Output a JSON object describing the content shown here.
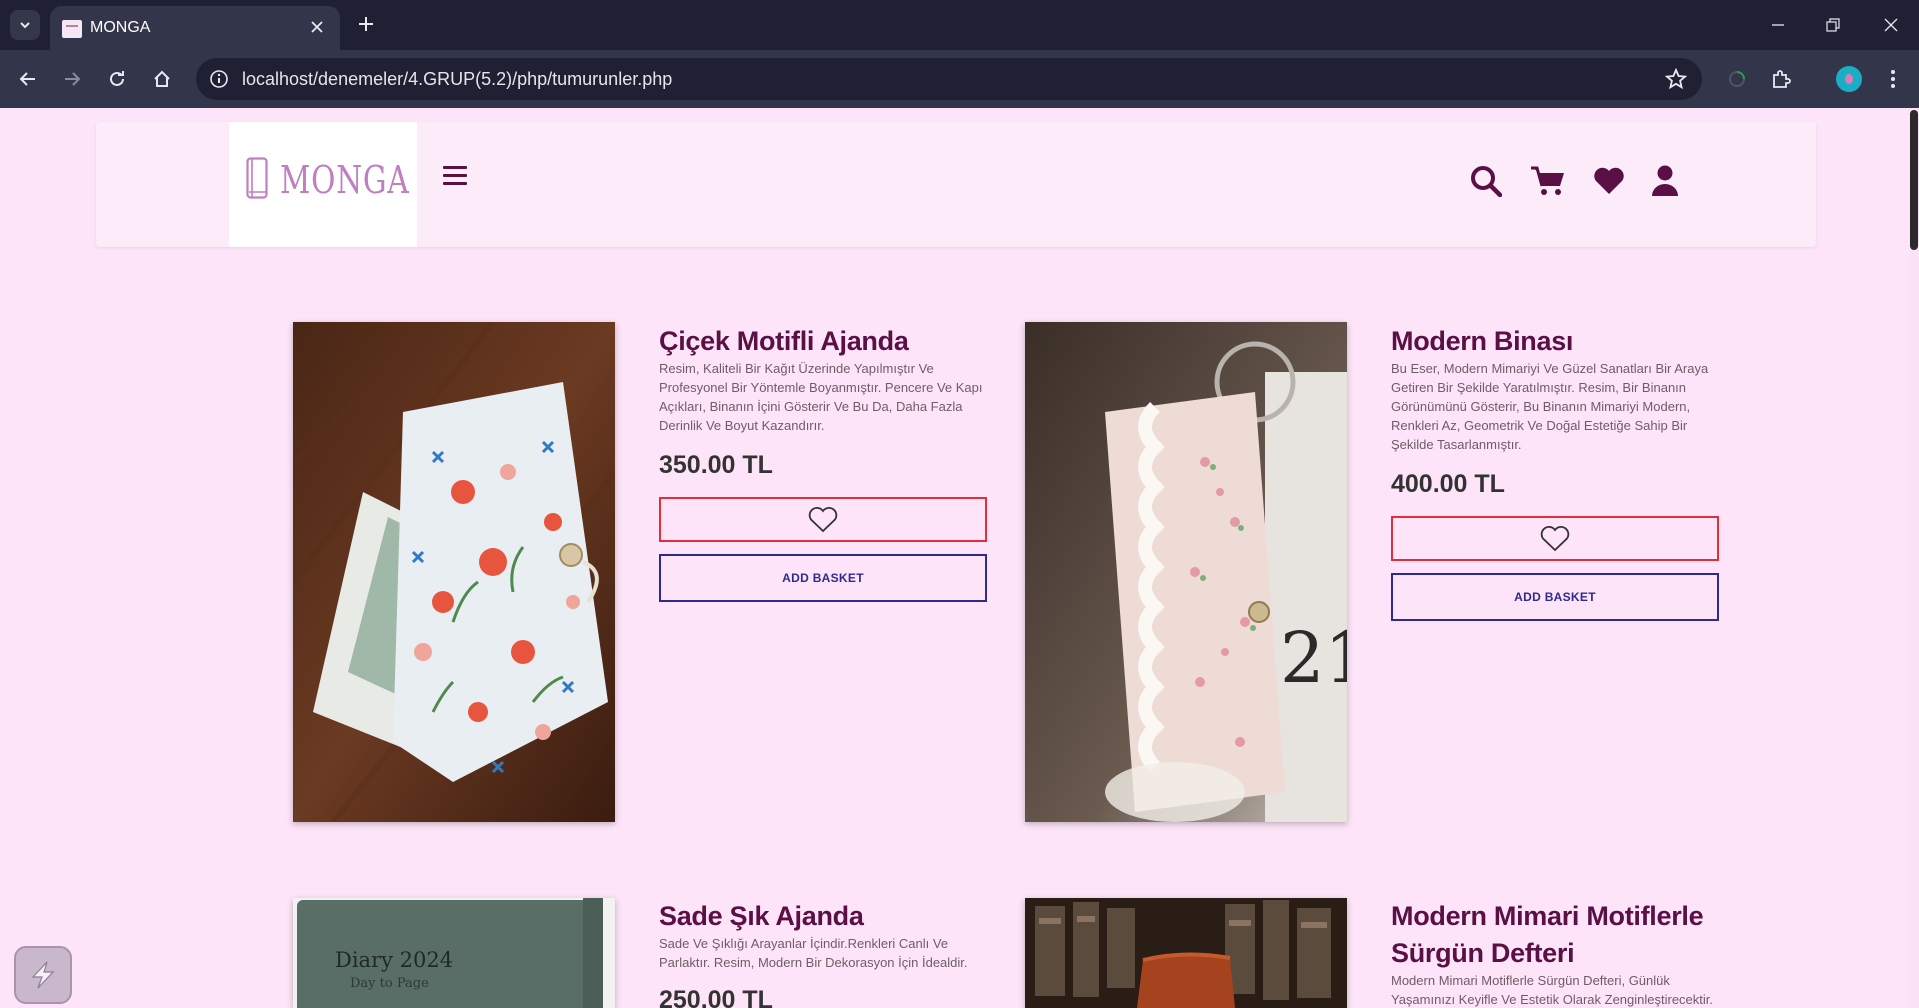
{
  "browser": {
    "tab_title": "MONGA",
    "url": "localhost/denemeler/4.GRUP(5.2)/php/tumurunler.php"
  },
  "header": {
    "logo_text": "MONGA",
    "icons": [
      "search-icon",
      "cart-icon",
      "heart-icon",
      "user-icon"
    ]
  },
  "colors": {
    "page_bg": "#fde4f8",
    "brand": "#5a0f45",
    "favorite_border": "#e02f38",
    "basket_border": "#2e2b8f"
  },
  "products": [
    {
      "title": "Çiçek Motifli Ajanda",
      "description": "Resim, Kaliteli Bir Kağıt Üzerinde Yapılmıştır Ve Profesyonel Bir Yöntemle Boyanmıştır. Pencere Ve Kapı Açıkları, Binanın İçini Gösterir Ve Bu Da, Daha Fazla Derinlik Ve Boyut Kazandırır.",
      "price": "350.00 TL",
      "basket_label": "ADD BASKET"
    },
    {
      "title": "Modern Binası",
      "description": "Bu Eser, Modern Mimariyi Ve Güzel Sanatları Bir Araya Getiren Bir Şekilde Yaratılmıştır. Resim, Bir Binanın Görünümünü Gösterir, Bu Binanın Mimariyi Modern, Renkleri Az, Geometrik Ve Doğal Estetiğe Sahip Bir Şekilde Tasarlanmıştır.",
      "price": "400.00 TL",
      "basket_label": "ADD BASKET"
    },
    {
      "title": "Sade Şık Ajanda",
      "description": "Sade Ve Şıklığı Arayanlar İçindir.Renkleri Canlı Ve Parlaktır. Resim, Modern Bir Dekorasyon İçin İdealdir.",
      "price": "250.00 TL",
      "image_text_1": "Diary 2024",
      "image_text_2": "Day to Page"
    },
    {
      "title": "Modern Mimari Motiflerle Sürgün Defteri",
      "description": "Modern Mimari Motiflerle Sürgün Defteri, Günlük Yaşamınızı Keyifle Ve Estetik Olarak Zenginleştirecektir."
    }
  ]
}
